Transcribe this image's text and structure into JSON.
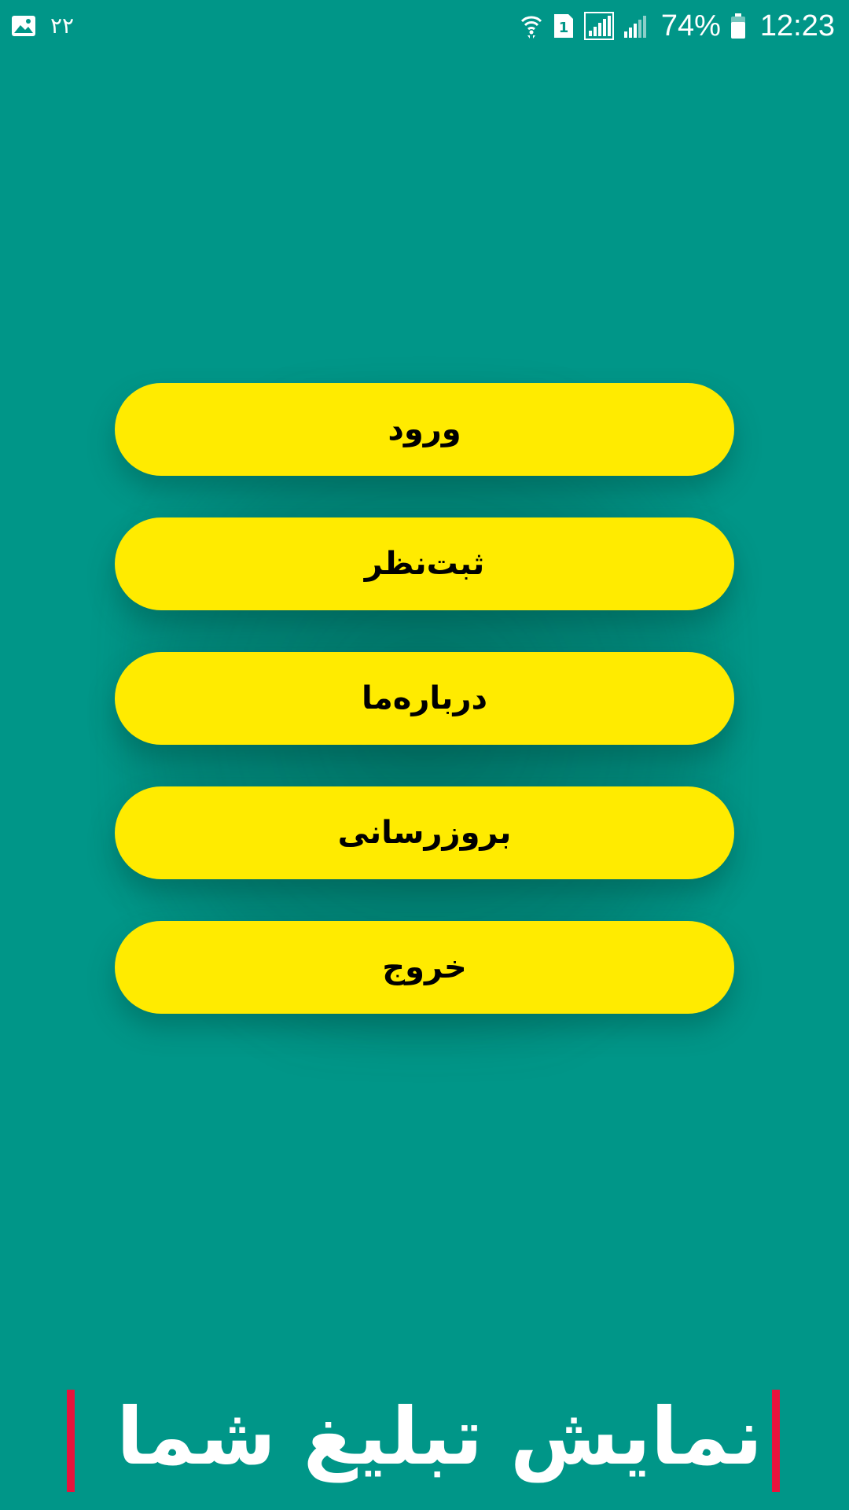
{
  "status_bar": {
    "notification_count": "۲۲",
    "battery_percent": "74%",
    "time": "12:23",
    "icons": [
      "gallery-icon",
      "wifi-icon",
      "sim-icon",
      "signal-icon",
      "signal-icon-2",
      "battery-icon"
    ]
  },
  "menu": {
    "items": [
      {
        "label": "ورود"
      },
      {
        "label": "ثبت‌نظر"
      },
      {
        "label": "درباره‌ما"
      },
      {
        "label": "بروزرسانی"
      },
      {
        "label": "خروج"
      }
    ]
  },
  "ad": {
    "text": "نمایش تبلیغ شما !!"
  },
  "colors": {
    "background": "#009688",
    "button": "#ffeb00",
    "button_text": "#000000",
    "ad_accent": "#e8123c",
    "ad_text": "#ffffff"
  }
}
